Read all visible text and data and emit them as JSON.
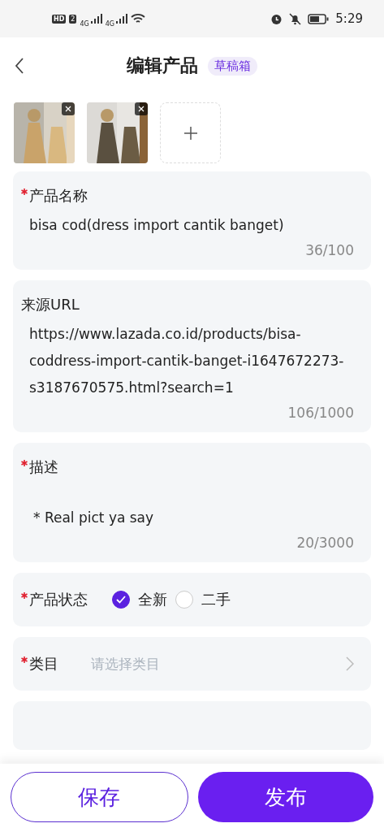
{
  "status_bar": {
    "hd": "HD",
    "sim": "2",
    "networks": [
      "4G",
      "4G"
    ],
    "time": "5:29"
  },
  "header": {
    "title": "编辑产品",
    "badge": "草稿箱"
  },
  "fields": [
    {
      "kind": "text",
      "label": "产品名称",
      "required": true,
      "value": "bisa cod(dress import cantik banget)",
      "counter": "36/100"
    },
    {
      "kind": "text",
      "label": "来源URL",
      "required": false,
      "value": "https://www.lazada.co.id/products/bisa-coddress-import-cantik-banget-i1647672273-s3187670575.html?search=1",
      "counter": "106/1000"
    },
    {
      "kind": "textarea",
      "label": "描述",
      "required": true,
      "value": "* Real pict ya say",
      "counter": "20/3000"
    },
    {
      "kind": "radio",
      "label": "产品状态",
      "required": true,
      "options": [
        {
          "label": "全新",
          "selected": true
        },
        {
          "label": "二手",
          "selected": false
        }
      ]
    },
    {
      "kind": "select",
      "label": "类目",
      "required": true,
      "placeholder": "请选择类目"
    }
  ],
  "buttons": {
    "save": "保存",
    "publish": "发布"
  }
}
